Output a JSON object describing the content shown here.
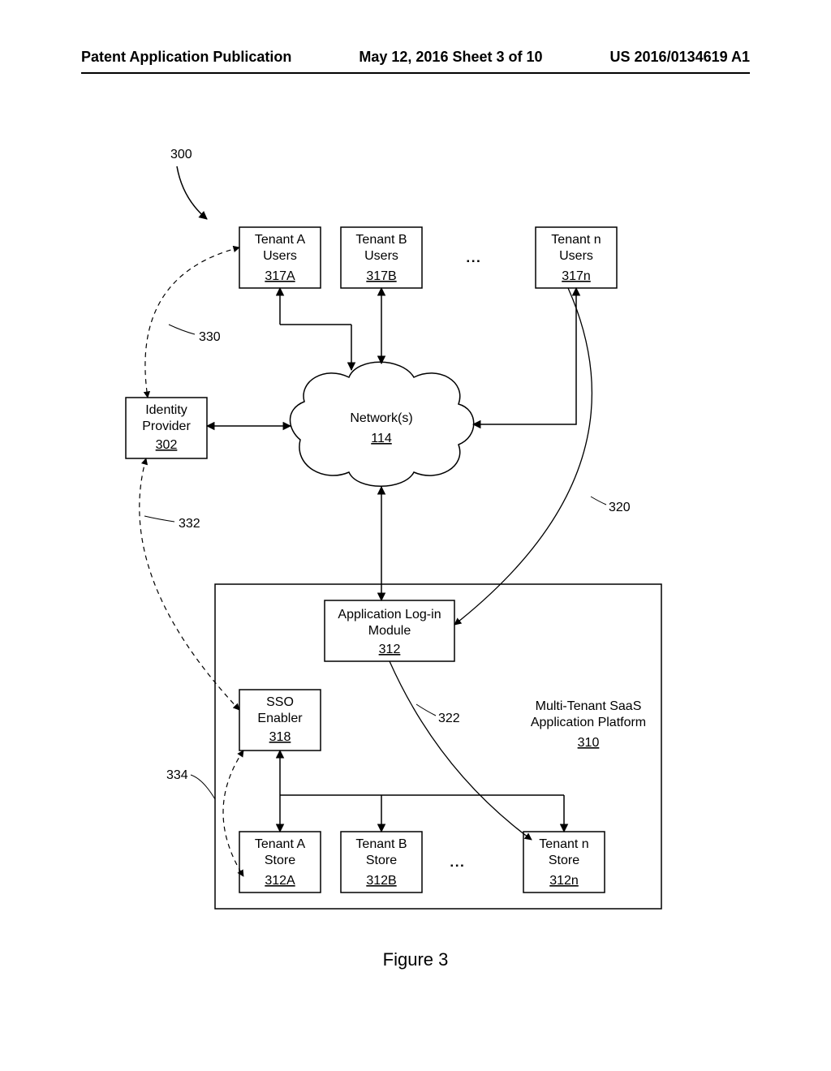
{
  "header": {
    "left": "Patent Application Publication",
    "center": "May 12, 2016  Sheet 3 of 10",
    "right": "US 2016/0134619 A1"
  },
  "diagram": {
    "figure_label": "Figure 3",
    "system_ref": "300",
    "tenant_a_users": {
      "label1": "Tenant A",
      "label2": "Users",
      "ref": "317A"
    },
    "tenant_b_users": {
      "label1": "Tenant B",
      "label2": "Users",
      "ref": "317B"
    },
    "tenant_n_users": {
      "label1": "Tenant n",
      "label2": "Users",
      "ref": "317n"
    },
    "identity_provider": {
      "label1": "Identity",
      "label2": "Provider",
      "ref": "302"
    },
    "network": {
      "label": "Network(s)",
      "ref": "114"
    },
    "login_module": {
      "label1": "Application Log-in",
      "label2": "Module",
      "ref": "312"
    },
    "sso_enabler": {
      "label1": "SSO",
      "label2": "Enabler",
      "ref": "318"
    },
    "platform": {
      "label1": "Multi-Tenant SaaS",
      "label2": "Application Platform",
      "ref": "310"
    },
    "store_a": {
      "label1": "Tenant A",
      "label2": "Store",
      "ref": "312A"
    },
    "store_b": {
      "label1": "Tenant B",
      "label2": "Store",
      "ref": "312B"
    },
    "store_n": {
      "label1": "Tenant n",
      "label2": "Store",
      "ref": "312n"
    },
    "ref_320": "320",
    "ref_322": "322",
    "ref_330": "330",
    "ref_332": "332",
    "ref_334": "334",
    "ellipsis": "▪   ▪   ▪"
  }
}
